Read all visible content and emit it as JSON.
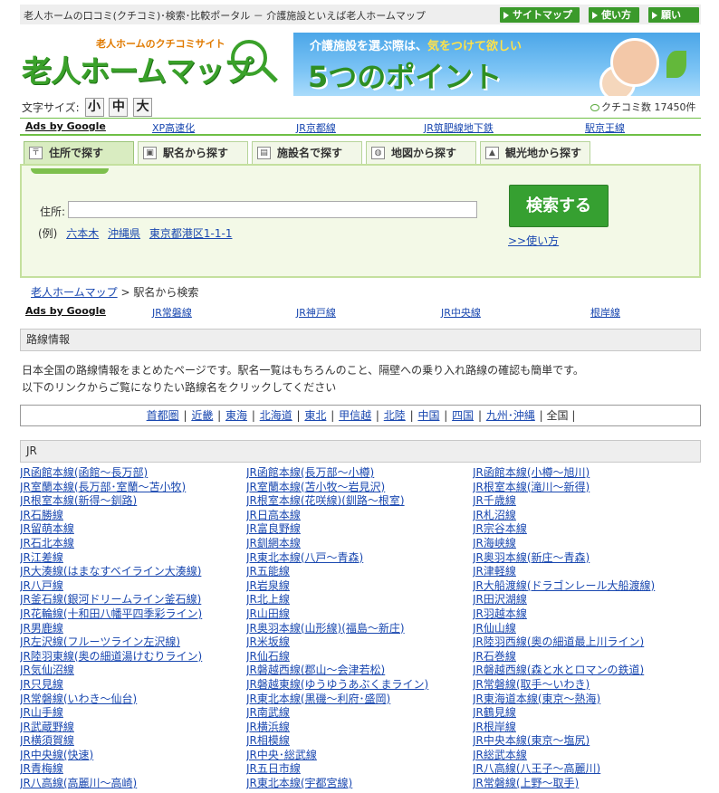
{
  "topbar": {
    "tagline": "老人ホームの口コミ(クチコミ)･検索･比較ポータル － 介護施設といえば老人ホームマップ",
    "sitemap": "サイトマップ",
    "howto": "使い方",
    "request": "願い"
  },
  "logo": {
    "sub": "老人ホームのクチコミサイト",
    "main": "老人ホームマップ"
  },
  "banner": {
    "line1_a": "介護施設を選ぶ際は、",
    "line1_b": "気をつけて欲しい",
    "line2": "5つのポイント"
  },
  "fontsize": {
    "label": "文字サイズ:",
    "small": "小",
    "medium": "中",
    "large": "大"
  },
  "kuchikomi": "クチコミ数 17450件",
  "ads1": {
    "label": "Ads by Google",
    "links": [
      "XP高速化",
      "JR京都線",
      "JR筑肥線地下鉄",
      "駅京王線"
    ]
  },
  "tabs": [
    "住所で探す",
    "駅名から探す",
    "施設名で探す",
    "地図から探す",
    "観光地から探す"
  ],
  "search": {
    "label": "住所:",
    "value": "",
    "example_prefix": "(例)",
    "examples": [
      "六本木",
      "沖縄県",
      "東京都港区1-1-1"
    ],
    "button": "検索する",
    "howto": ">>使い方"
  },
  "breadcrumb": {
    "home": "老人ホームマップ",
    "sep": " > ",
    "current": "駅名から検索"
  },
  "ads2": {
    "label": "Ads by Google",
    "links": [
      "JR常磐線",
      "JR神戸線",
      "JR中央線",
      "根岸線"
    ]
  },
  "route_section": {
    "title": "路線情報",
    "intro1": "日本全国の路線情報をまとめたページです。駅名一覧はもちろんのこと、隔壁への乗り入れ路線の確認も簡単です。",
    "intro2": "以下のリンクからご覧になりたい路線名をクリックしてください"
  },
  "regions": [
    "首都圏",
    "近畿",
    "東海",
    "北海道",
    "東北",
    "甲信越",
    "北陸",
    "中国",
    "四国",
    "九州･沖縄",
    "全国"
  ],
  "jr_section": {
    "title": "JR"
  },
  "jr_lines": [
    [
      "JR函館本線(函館～長万部)",
      "JR室蘭本線(長万部･室蘭～苫小牧)",
      "JR根室本線(新得～釧路)",
      "JR石勝線",
      "JR留萌本線",
      "JR石北本線",
      "JR江差線",
      "JR大湊線(はまなすベイライン大湊線)",
      "JR八戸線",
      "JR釜石線(銀河ドリームライン釜石線)",
      "JR花輪線(十和田八幡平四季彩ライン)",
      "JR男鹿線",
      "JR左沢線(フルーツライン左沢線)",
      "JR陸羽東線(奥の細道湯けむりライン)",
      "JR気仙沼線",
      "JR只見線",
      "JR常磐線(いわき～仙台)",
      "JR山手線",
      "JR武蔵野線",
      "JR横須賀線",
      "JR中央線(快速)",
      "JR青梅線",
      "JR八高線(高麗川～高崎)"
    ],
    [
      "JR函館本線(長万部～小樽)",
      "JR室蘭本線(苫小牧～岩見沢)",
      "JR根室本線(花咲線)(釧路～根室)",
      "JR日高本線",
      "JR富良野線",
      "JR釧網本線",
      "JR東北本線(八戸～青森)",
      "JR五能線",
      "JR岩泉線",
      "JR北上線",
      "JR山田線",
      "JR奥羽本線(山形線)(福島～新庄)",
      "JR米坂線",
      "JR仙石線",
      "JR磐越西線(郡山～会津若松)",
      "JR磐越東線(ゆうゆうあぶくまライン)",
      "JR東北本線(黒磯～利府･盛岡)",
      "JR南武線",
      "JR横浜線",
      "JR相模線",
      "JR中央･総武線",
      "JR五日市線",
      "JR東北本線(宇都宮線)"
    ],
    [
      "JR函館本線(小樽～旭川)",
      "JR根室本線(滝川～新得)",
      "JR千歳線",
      "JR札沼線",
      "JR宗谷本線",
      "JR海峡線",
      "JR奥羽本線(新庄～青森)",
      "JR津軽線",
      "JR大船渡線(ドラゴンレール大船渡線)",
      "JR田沢湖線",
      "JR羽越本線",
      "JR仙山線",
      "JR陸羽西線(奥の細道最上川ライン)",
      "JR石巻線",
      "JR磐越西線(森と水とロマンの鉄道)",
      "JR常磐線(取手～いわき)",
      "JR東海道本線(東京～熱海)",
      "JR鶴見線",
      "JR根岸線",
      "JR中央本線(東京～塩尻)",
      "JR総武本線",
      "JR八高線(八王子～高麗川)",
      "JR常磐線(上野～取手)"
    ]
  ]
}
